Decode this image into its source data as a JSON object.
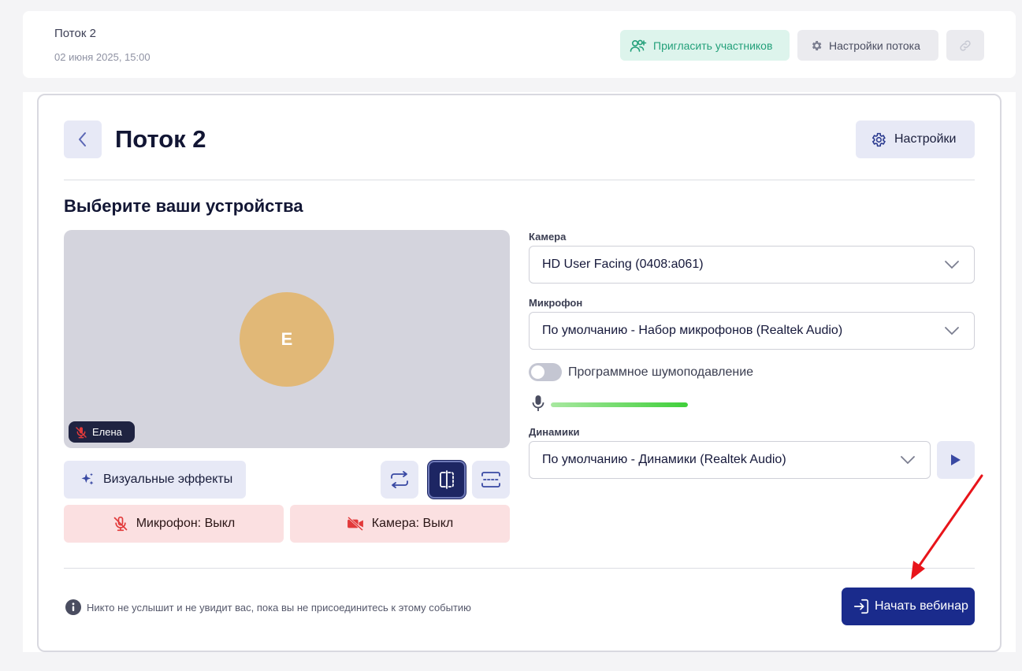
{
  "header": {
    "stream_name": "Поток 2",
    "stream_date": "02 июня 2025, 15:00",
    "invite_label": "Пригласить участников",
    "stream_settings_label": "Настройки потока",
    "invite_icon": "users-plus-icon",
    "settings_icon": "gear-icon",
    "link_icon": "link-icon"
  },
  "page": {
    "title": "Поток 2",
    "settings_label": "Настройки",
    "section_title": "Выберите ваши устройства"
  },
  "preview": {
    "avatar_initial": "Е",
    "user_name": "Елена"
  },
  "controls": {
    "effects_label": "Визуальные эффекты",
    "mic_off_label": "Микрофон: Выкл",
    "camera_off_label": "Камера: Выкл"
  },
  "devices": {
    "camera_label": "Камера",
    "camera_value": "HD User Facing (0408:a061)",
    "mic_label": "Микрофон",
    "mic_value": "По умолчанию - Набор микрофонов (Realtek Audio)",
    "noise_label": "Программное шумоподавление",
    "noise_enabled": false,
    "mic_level": 1.0,
    "speakers_label": "Динамики",
    "speakers_value": "По умолчанию - Динамики (Realtek Audio)"
  },
  "footer": {
    "info_text": "Никто не услышит и не увидит вас, пока вы не присоединитесь к этому событию",
    "start_label": "Начать вебинар"
  },
  "colors": {
    "primary": "#1a2b8c",
    "invite_green": "#23a07a",
    "danger_bg": "#fbe0e1",
    "danger_icon": "#e23a3a",
    "avatar": "#e1b877",
    "annotation_arrow": "#e8141a"
  }
}
